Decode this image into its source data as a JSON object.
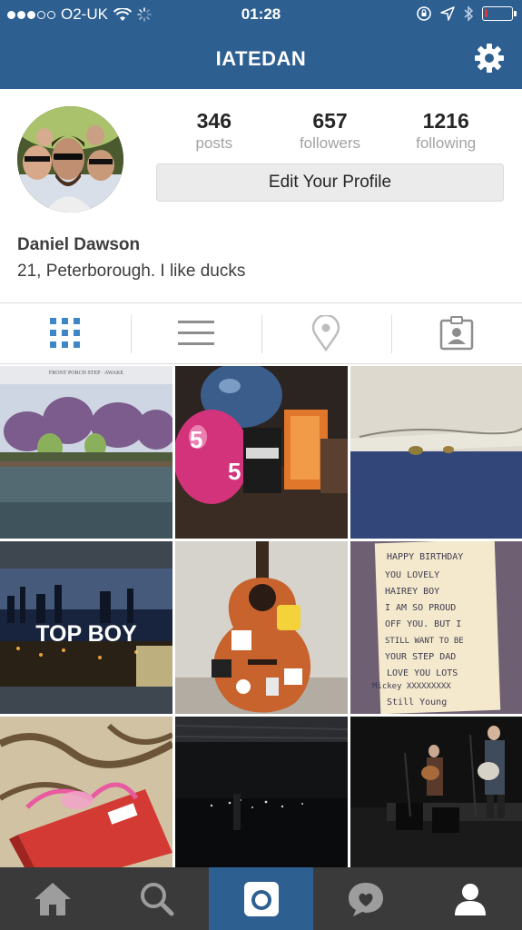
{
  "status_bar": {
    "carrier": "O2-UK",
    "time": "01:28",
    "signal_dots": 3,
    "battery_level": 0.12,
    "battery_color": "#e33333"
  },
  "nav": {
    "title": "IATEDAN",
    "settings_icon": "gear-icon",
    "bar_color": "#2d5f91"
  },
  "profile": {
    "stats": [
      {
        "value": "346",
        "label": "posts"
      },
      {
        "value": "657",
        "label": "followers"
      },
      {
        "value": "1216",
        "label": "following"
      }
    ],
    "edit_button": "Edit Your Profile",
    "name": "Daniel Dawson",
    "bio": "21, Peterborough. I like ducks"
  },
  "tabs": [
    {
      "icon": "grid-view-icon",
      "active": true
    },
    {
      "icon": "list-view-icon",
      "active": false
    },
    {
      "icon": "location-pin-icon",
      "active": false
    },
    {
      "icon": "tagged-photos-icon",
      "active": false
    }
  ],
  "photos": {
    "album_caption": "FRONT PORCH STEP · AWAKE",
    "tv_title": "TOP BOY",
    "balloon_digit": "5",
    "note_lines": [
      "HAPPY BIRTHDAY",
      "YOU LOVELY",
      "HAIREY BOY",
      "I AM SO PROUD",
      "OFF YOU. BUT I",
      "STILL WANT TO BE",
      "YOUR STEP DAD",
      "LOVE YOU LOTS",
      "Mickey XXXXXXXXX",
      "Still Young"
    ]
  },
  "bottom_nav": [
    {
      "icon": "home-icon",
      "active": false
    },
    {
      "icon": "search-icon",
      "active": false
    },
    {
      "icon": "camera-icon",
      "active": true
    },
    {
      "icon": "activity-icon",
      "active": false
    },
    {
      "icon": "profile-icon",
      "active": true
    }
  ]
}
